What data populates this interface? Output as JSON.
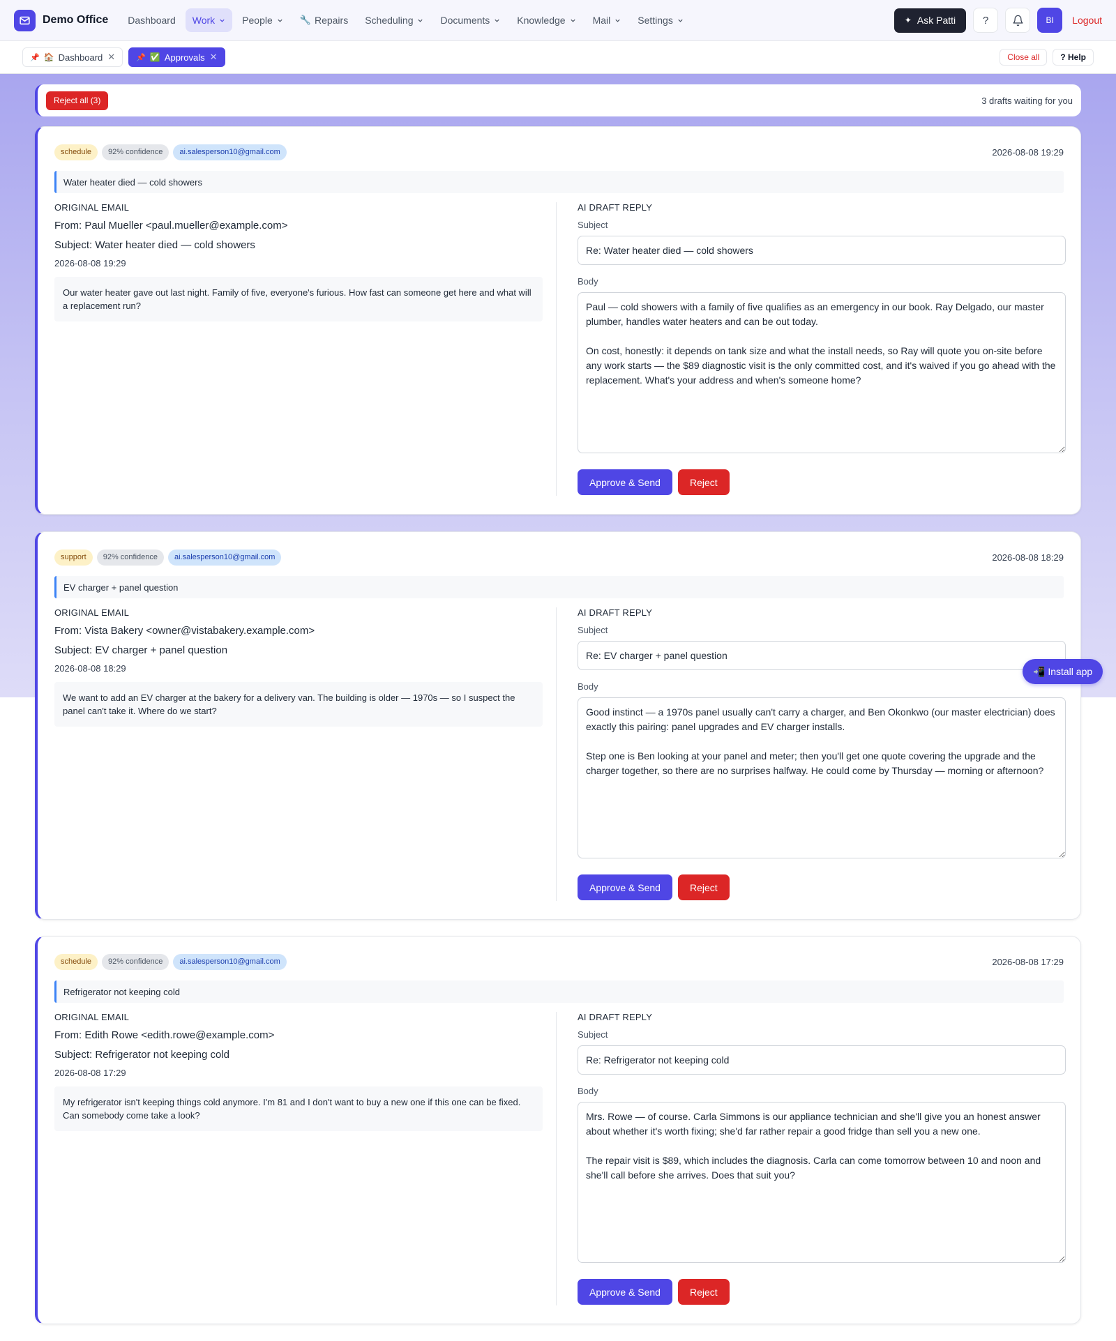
{
  "brand": {
    "name": "Demo Office"
  },
  "nav": {
    "items": [
      {
        "label": "Dashboard",
        "dropdown": false,
        "active": false
      },
      {
        "label": "Work",
        "dropdown": true,
        "active": true
      },
      {
        "label": "People",
        "dropdown": true,
        "active": false
      },
      {
        "label": "Repairs",
        "dropdown": false,
        "active": false,
        "icon": "wrench-icon"
      },
      {
        "label": "Scheduling",
        "dropdown": true,
        "active": false
      },
      {
        "label": "Documents",
        "dropdown": true,
        "active": false
      },
      {
        "label": "Knowledge",
        "dropdown": true,
        "active": false
      },
      {
        "label": "Mail",
        "dropdown": true,
        "active": false
      },
      {
        "label": "Settings",
        "dropdown": true,
        "active": false
      }
    ],
    "ask_label": "Ask Patti",
    "help_symbol": "?",
    "avatar_initials": "BI",
    "logout_label": "Logout"
  },
  "tabs": {
    "items": [
      {
        "emoji": "🏠",
        "label": "Dashboard",
        "active": false
      },
      {
        "emoji": "✅",
        "label": "Approvals",
        "active": true
      }
    ],
    "close_all_label": "Close all",
    "help_label": "? Help"
  },
  "actionbar": {
    "reject_all_label": "Reject all (3)",
    "waiting_text": "3 drafts waiting for you"
  },
  "labels": {
    "original_email": "ORIGINAL EMAIL",
    "ai_draft_reply": "AI DRAFT REPLY",
    "subject": "Subject",
    "body": "Body",
    "approve": "Approve & Send",
    "reject": "Reject"
  },
  "drafts": [
    {
      "category": "schedule",
      "confidence": "92% confidence",
      "account": "ai.salesperson10@gmail.com",
      "date": "2026-08-08 19:29",
      "topic": "Water heater died — cold showers",
      "from": "From: Paul Mueller <paul.mueller@example.com>",
      "subject": "Subject: Water heater died — cold showers",
      "email_date": "2026-08-08 19:29",
      "email_body": "Our water heater gave out last night. Family of five, everyone's furious. How fast can someone get here and what will a replacement run?",
      "reply_subject": "Re: Water heater died — cold showers",
      "reply_body": "Paul — cold showers with a family of five qualifies as an emergency in our book. Ray Delgado, our master plumber, handles water heaters and can be out today.\n\nOn cost, honestly: it depends on tank size and what the install needs, so Ray will quote you on-site before any work starts — the $89 diagnostic visit is the only committed cost, and it's waived if you go ahead with the replacement. What's your address and when's someone home?"
    },
    {
      "category": "support",
      "confidence": "92% confidence",
      "account": "ai.salesperson10@gmail.com",
      "date": "2026-08-08 18:29",
      "topic": "EV charger + panel question",
      "from": "From: Vista Bakery <owner@vistabakery.example.com>",
      "subject": "Subject: EV charger + panel question",
      "email_date": "2026-08-08 18:29",
      "email_body": "We want to add an EV charger at the bakery for a delivery van. The building is older — 1970s — so I suspect the panel can't take it. Where do we start?",
      "reply_subject": "Re: EV charger + panel question",
      "reply_body": "Good instinct — a 1970s panel usually can't carry a charger, and Ben Okonkwo (our master electrician) does exactly this pairing: panel upgrades and EV charger installs.\n\nStep one is Ben looking at your panel and meter; then you'll get one quote covering the upgrade and the charger together, so there are no surprises halfway. He could come by Thursday — morning or afternoon?"
    },
    {
      "category": "schedule",
      "confidence": "92% confidence",
      "account": "ai.salesperson10@gmail.com",
      "date": "2026-08-08 17:29",
      "topic": "Refrigerator not keeping cold",
      "from": "From: Edith Rowe <edith.rowe@example.com>",
      "subject": "Subject: Refrigerator not keeping cold",
      "email_date": "2026-08-08 17:29",
      "email_body": "My refrigerator isn't keeping things cold anymore. I'm 81 and I don't want to buy a new one if this one can be fixed. Can somebody come take a look?",
      "reply_subject": "Re: Refrigerator not keeping cold",
      "reply_body": "Mrs. Rowe — of course. Carla Simmons is our appliance technician and she'll give you an honest answer about whether it's worth fixing; she'd far rather repair a good fridge than sell you a new one.\n\nThe repair visit is $89, which includes the diagnosis. Carla can come tomorrow between 10 and noon and she'll call before she arrives. Does that suit you?"
    }
  ],
  "install_app_label": "📲 Install app"
}
